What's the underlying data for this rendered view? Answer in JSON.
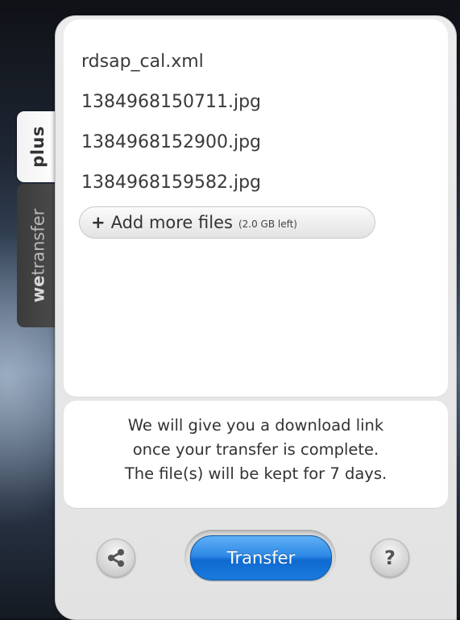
{
  "tabs": {
    "plus_label": "plus",
    "wetransfer_label_bold": "we",
    "wetransfer_label_rest": "transfer"
  },
  "files": [
    "rdsap_cal.xml",
    "1384968150711.jpg",
    "1384968152900.jpg",
    "1384968159582.jpg"
  ],
  "add_files": {
    "plus": "+",
    "label": "Add more files",
    "remaining": "(2.0 GB left)"
  },
  "info": {
    "line1": "We will give you a download link",
    "line2": "once your transfer is complete.",
    "line3": "The file(s) will be kept for 7 days."
  },
  "actions": {
    "share_icon": "share-icon",
    "transfer_label": "Transfer",
    "help_label": "?"
  },
  "colors": {
    "transfer_blue": "#1b79dd"
  }
}
